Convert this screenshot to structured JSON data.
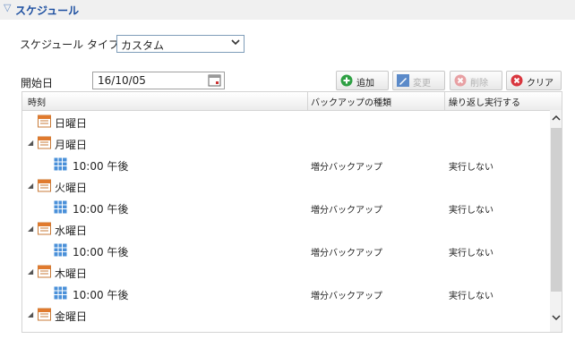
{
  "section": {
    "title": "スケジュール"
  },
  "schedule_type": {
    "label": "スケジュール タイプ",
    "value": "カスタム"
  },
  "start_date": {
    "label": "開始日",
    "value": "16/10/05"
  },
  "toolbar": {
    "add_label": "追加",
    "edit_label": "変更",
    "delete_label": "削除",
    "clear_label": "クリア"
  },
  "grid": {
    "headers": [
      "時刻",
      "バックアップの種類",
      "繰り返し実行する"
    ],
    "rows": [
      {
        "text": "日曜日"
      },
      {
        "text": "月曜日"
      },
      {
        "text": "10:00 午後",
        "type": "増分バックアップ",
        "repeat": "実行しない"
      },
      {
        "text": "火曜日"
      },
      {
        "text": "10:00 午後",
        "type": "増分バックアップ",
        "repeat": "実行しない"
      },
      {
        "text": "水曜日"
      },
      {
        "text": "10:00 午後",
        "type": "増分バックアップ",
        "repeat": "実行しない"
      },
      {
        "text": "木曜日"
      },
      {
        "text": "10:00 午後",
        "type": "増分バックアップ",
        "repeat": "実行しない"
      },
      {
        "text": "金曜日"
      }
    ]
  },
  "icons": {
    "expand": "collapse-triangle-icon",
    "day": "calendar-icon",
    "time": "grid-calendar-icon"
  },
  "colors": {
    "header_text": "#1d4fa0",
    "add_green": "#2ea043",
    "delete_red": "#d9363e"
  }
}
